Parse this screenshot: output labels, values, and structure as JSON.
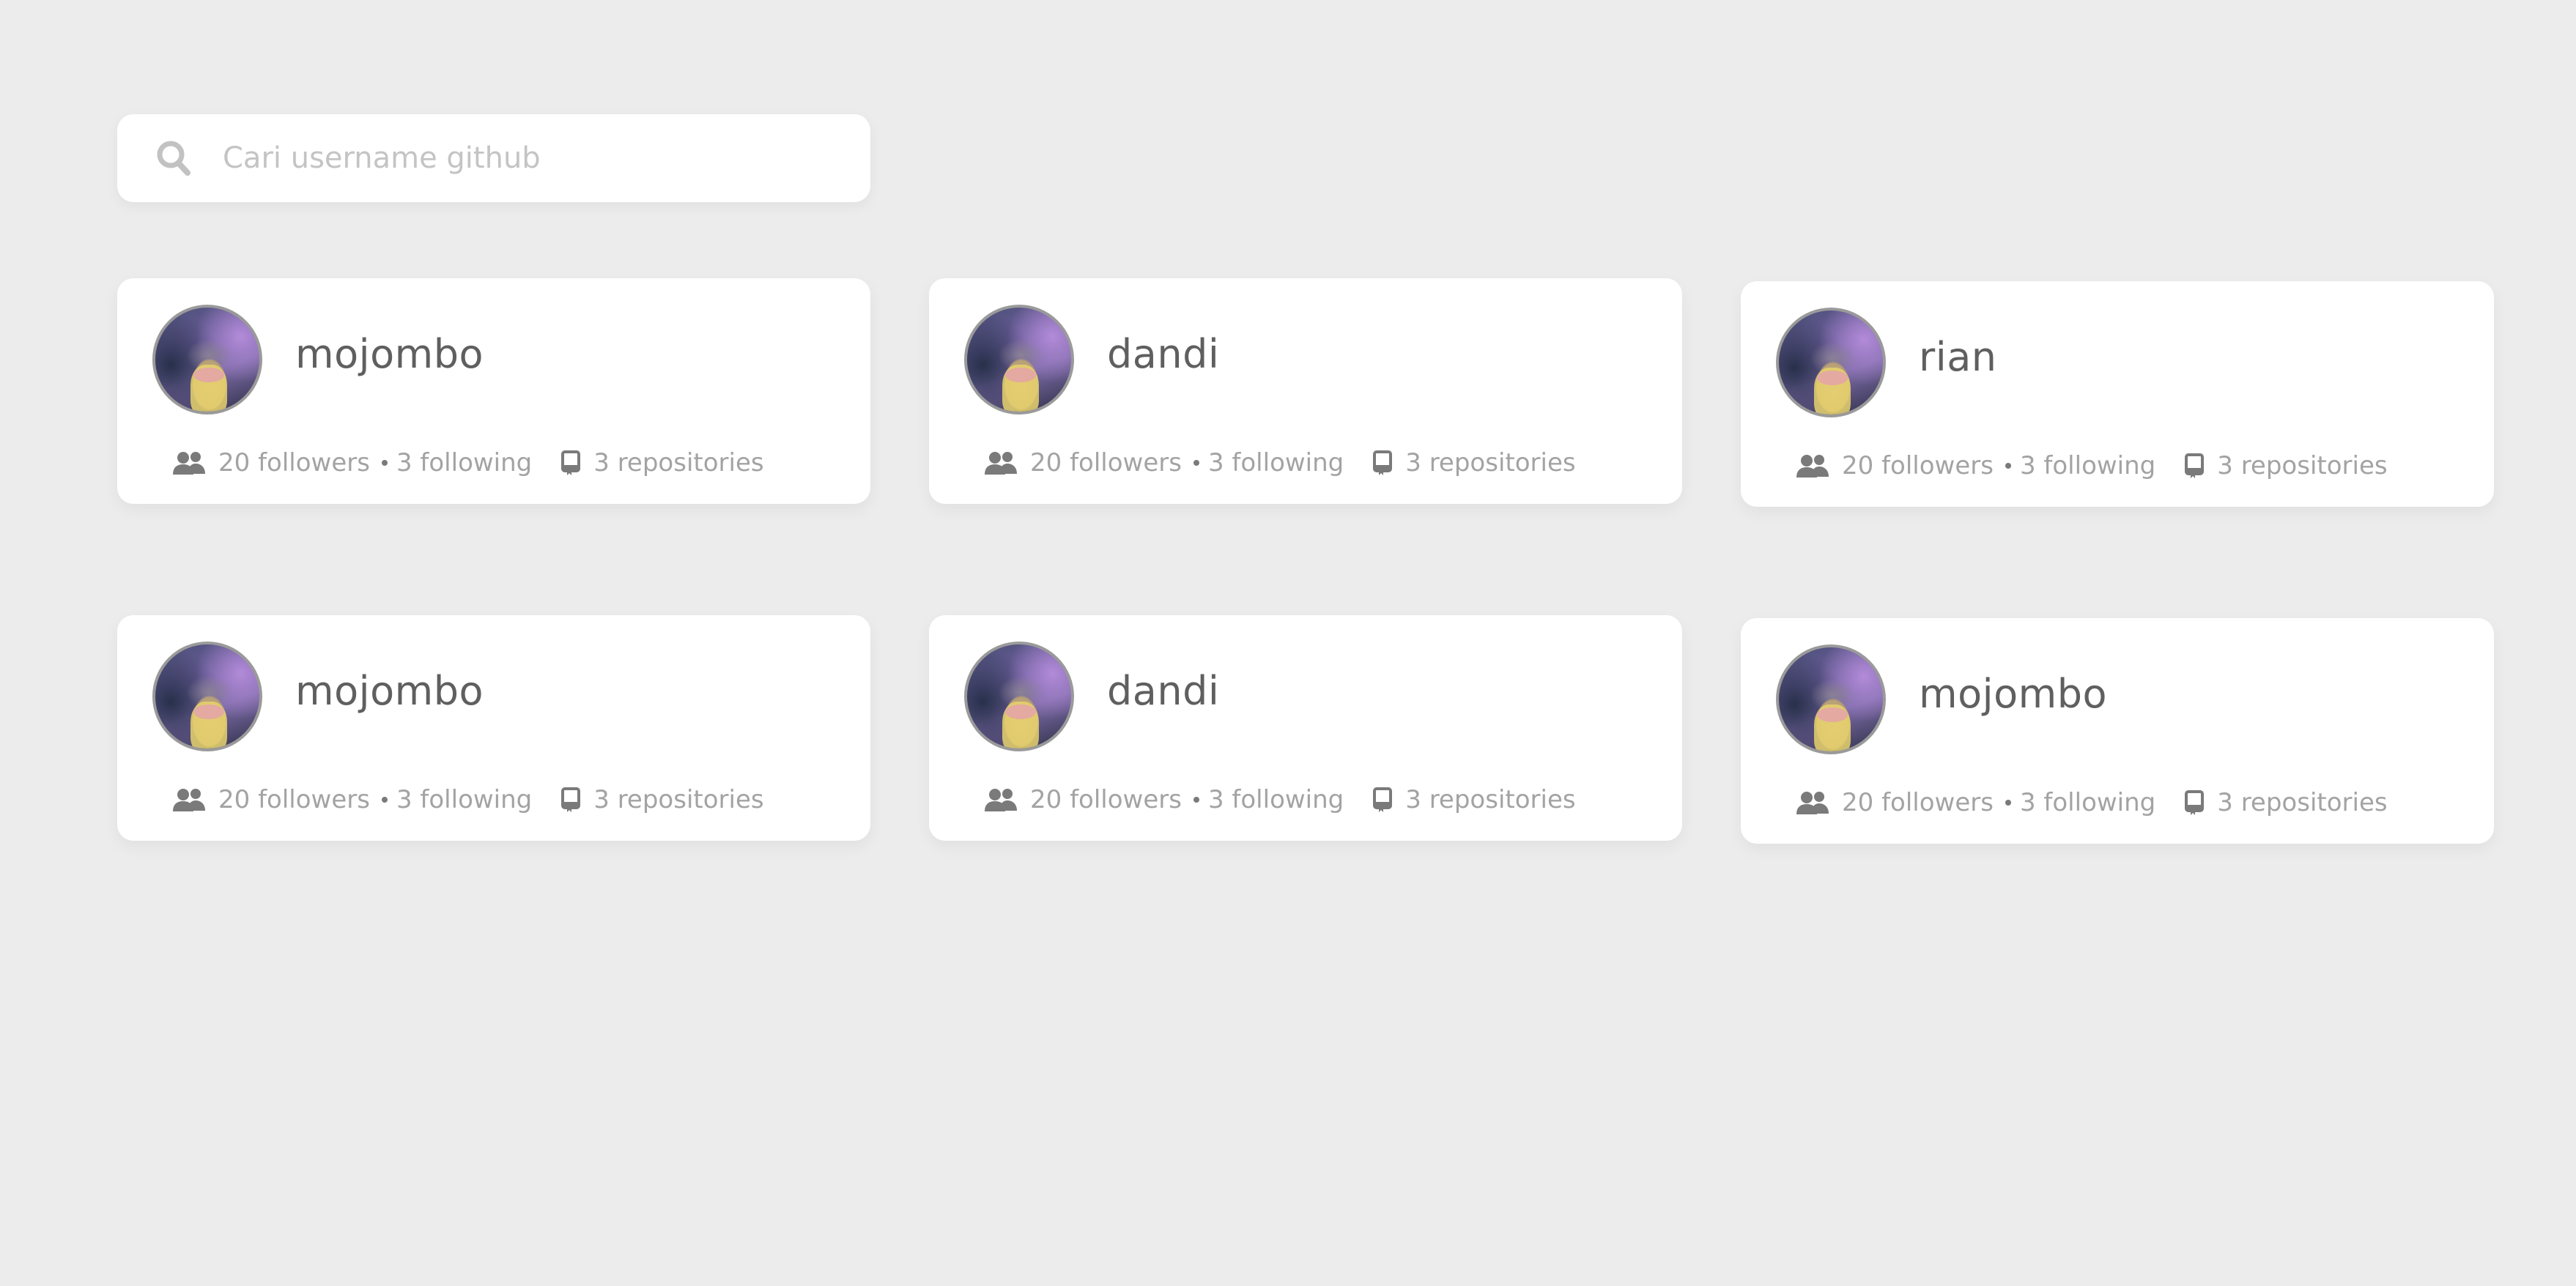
{
  "search": {
    "placeholder": "Cari username github",
    "value": ""
  },
  "users": [
    {
      "username": "mojombo",
      "followers": "20 followers",
      "following": "3 following",
      "repositories": "3 repositories"
    },
    {
      "username": "dandi",
      "followers": "20 followers",
      "following": "3 following",
      "repositories": "3 repositories"
    },
    {
      "username": "rian",
      "followers": "20 followers",
      "following": "3 following",
      "repositories": "3 repositories"
    },
    {
      "username": "mojombo",
      "followers": "20 followers",
      "following": "3 following",
      "repositories": "3 repositories"
    },
    {
      "username": "dandi",
      "followers": "20 followers",
      "following": "3 following",
      "repositories": "3 repositories"
    },
    {
      "username": "mojombo",
      "followers": "20 followers",
      "following": "3 following",
      "repositories": "3 repositories"
    }
  ],
  "icons": {
    "search": "search-icon",
    "followers": "people-icon",
    "repositories": "repo-book-icon"
  },
  "colors": {
    "background": "#ececec",
    "card": "#ffffff",
    "text_primary": "#5f5f5f",
    "text_secondary": "#a3a3a3",
    "icon": "#7a7a7a"
  }
}
